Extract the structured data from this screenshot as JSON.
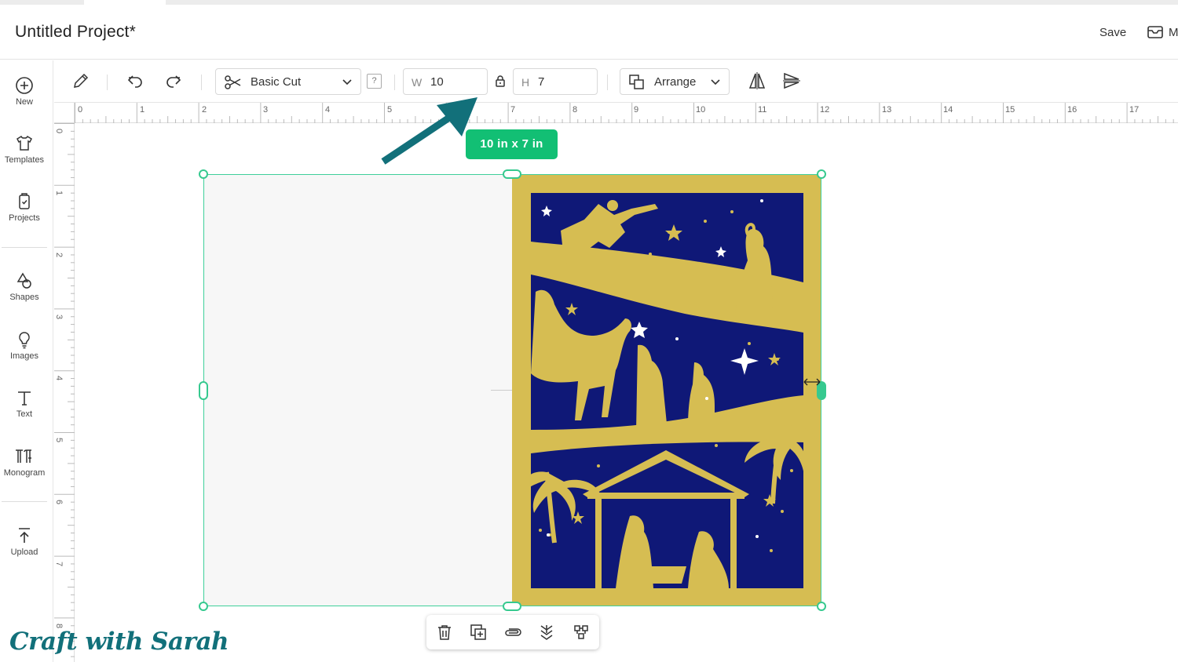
{
  "header": {
    "title": "Untitled Project*",
    "save_label": "Save",
    "make_label_partial": "M"
  },
  "sidebar": {
    "items": [
      {
        "label": "New",
        "icon": "plus-circle-icon"
      },
      {
        "label": "Templates",
        "icon": "tshirt-icon"
      },
      {
        "label": "Projects",
        "icon": "projects-icon"
      },
      {
        "label": "Shapes",
        "icon": "shapes-icon"
      },
      {
        "label": "Images",
        "icon": "lightbulb-icon"
      },
      {
        "label": "Text",
        "icon": "text-t-icon"
      },
      {
        "label": "Monogram",
        "icon": "monogram-icon"
      },
      {
        "label": "Upload",
        "icon": "upload-icon"
      }
    ]
  },
  "toolbar": {
    "operation_label": "Basic Cut",
    "help_label": "?",
    "width_label": "W",
    "width_value": "10",
    "height_label": "H",
    "height_value": "7",
    "arrange_label": "Arrange"
  },
  "rulers": {
    "horizontal": [
      "0",
      "1",
      "2",
      "3",
      "4",
      "5",
      "7",
      "8",
      "9",
      "10",
      "11",
      "12",
      "13",
      "14",
      "15",
      "16",
      "17"
    ],
    "vertical": [
      "0",
      "1",
      "2",
      "3",
      "4",
      "5",
      "6",
      "7",
      "8"
    ]
  },
  "canvas": {
    "dimension_badge": "10  in x 7  in",
    "artwork_colors": {
      "gold": "#d6bd52",
      "navy": "#0f1877"
    }
  },
  "accent_color": "#36c98f",
  "arrow_color": "#12707a",
  "watermark": "Craft with Sarah"
}
